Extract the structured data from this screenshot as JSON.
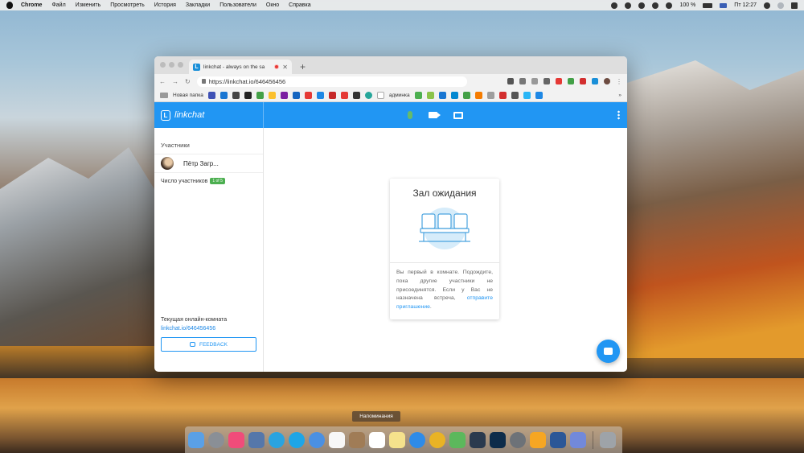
{
  "menubar": {
    "app": "Chrome",
    "items": [
      "Файл",
      "Изменить",
      "Просмотреть",
      "История",
      "Закладки",
      "Пользователи",
      "Окно",
      "Справка"
    ],
    "battery": "100 %",
    "clock": "Пт 12:27"
  },
  "browser": {
    "tab_title": "linkchat - always on the sa",
    "tab_favicon": "L",
    "url": "https://linkchat.io/646456456",
    "bookmarks": {
      "folder": "Новая папка",
      "admin": "админка"
    }
  },
  "app": {
    "brand": "linkchat",
    "sidebar": {
      "participants_title": "Участники",
      "participant_name": "Пётр Загр...",
      "count_label": "Число участников",
      "count_badge": "1 of 5",
      "room_label": "Текущая онлайн-комната",
      "room_link": "linkchat.io/646456456",
      "feedback_label": "FEEDBACK"
    },
    "waiting_room": {
      "title": "Зал ожидания",
      "text": "Вы первый в комнате. Подождите, пока другие участники не присоединятся. Если у Вас не назначена встреча,",
      "link": "отправите приглашение",
      "text_end": "."
    }
  },
  "dock": {
    "tooltip": "Напоминания"
  },
  "colors": {
    "primary": "#2196f3",
    "badge": "#4caf50",
    "mic": "#66bb6a"
  }
}
